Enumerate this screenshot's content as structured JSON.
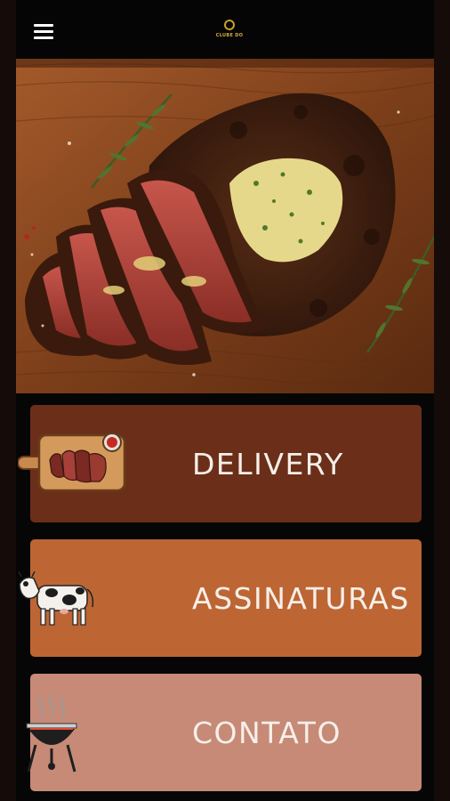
{
  "header": {
    "menu_icon": "hamburger-menu-icon",
    "logo_text": "CLUBE DO",
    "logo_icon": "club-logo"
  },
  "hero": {
    "image": "grilled-steak-with-herb-butter-on-wooden-board"
  },
  "tiles": [
    {
      "label": "DELIVERY",
      "icon": "steak-board-icon",
      "color": "#6b2f19"
    },
    {
      "label": "ASSINATURAS",
      "icon": "cow-icon",
      "color": "#bd6634"
    },
    {
      "label": "CONTATO",
      "icon": "grill-icon",
      "color": "#c68a77"
    }
  ]
}
